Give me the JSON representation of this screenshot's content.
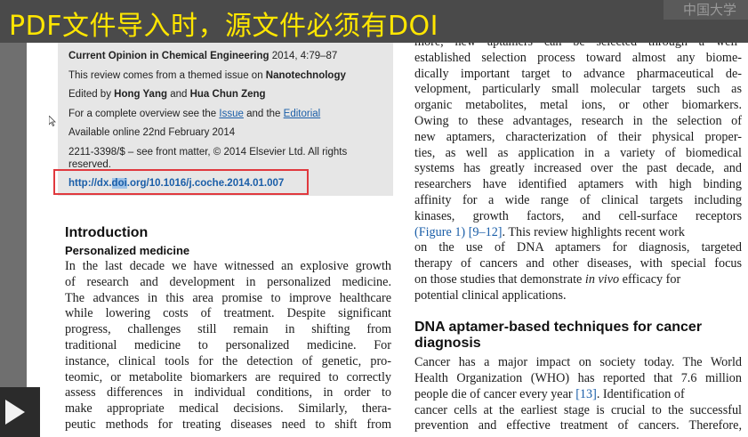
{
  "banner": {
    "title": "PDF文件导入时，源文件必须有DOI",
    "logo_text": "中国大学"
  },
  "infobox": {
    "journal": "Current Opinion in Chemical Engineering",
    "journal_rest": " 2014, 4:79–87",
    "themed_prefix": "This review comes from a themed issue on ",
    "themed_topic": "Nanotechnology",
    "edited_prefix": "Edited by ",
    "editor1": "Hong Yang",
    "and": " and ",
    "editor2": "Hua Chun Zeng",
    "overview_prefix": "For a complete overview see the ",
    "issue_link": "Issue",
    "and_the": " and the ",
    "editorial_link": "Editorial",
    "available": "Available online 22nd February 2014",
    "copyright_line1": "2211-3398/$ – see front matter, © 2014 Elsevier Ltd. All rights",
    "copyright_line2": "reserved.",
    "doi_prefix": "http://dx.",
    "doi_highlight": "doi",
    "doi_suffix": ".org/10.1016/j.coche.2014.01.007"
  },
  "left_column": {
    "heading": "Introduction",
    "subheading": "Personalized medicine",
    "lines": [
      "In the last decade we have witnessed an explosive growth",
      "of research and development in personalized medicine.",
      "The advances in this area promise to improve healthcare",
      "while lowering costs of treatment. Despite significant",
      "progress, challenges still remain in shifting from",
      "traditional medicine to personalized medicine. For",
      "instance, clinical tools for the detection of genetic, pro-",
      "teomic, or metabolite biomarkers are required to correctly",
      "assess differences in individual conditions, in order to",
      "make appropriate medical decisions. Similarly, thera-",
      "peutic methods for treating diseases need to shift from"
    ]
  },
  "right_column": {
    "top_cut": "more, new aptamers can be selected through a well-",
    "lines": [
      "established selection process toward almost any biome-",
      "dically important target to advance pharmaceutical de-",
      "velopment, particularly small molecular targets such as",
      "organic metabolites, metal ions, or other biomarkers.",
      "Owing to these advantages, research in the selection of",
      "new aptamers, characterization of their physical proper-",
      "ties, as well as application in a variety of biomedical",
      "systems has greatly increased over the past decade, and",
      "researchers have identified aptamers with high binding",
      "affinity for a wide range of clinical targets including",
      "kinases, growth factors, and cell-surface receptors"
    ],
    "figure_ref": "(Figure 1)",
    "ref_9_12": "[9–12]",
    "line12_rest": ". This review highlights recent work",
    "line13": "on the use of DNA aptamers for diagnosis, targeted",
    "line14": "therapy of cancers and other diseases, with special focus",
    "line15_prefix": "on those studies that demonstrate ",
    "in_vivo": "in vivo",
    "line15_suffix": " efficacy for",
    "line16": "potential clinical applications.",
    "heading": "DNA aptamer-based techniques for cancer diagnosis",
    "sec_line1": "Cancer has a major impact on society today. The World",
    "sec_line2": "Health Organization (WHO) has reported that 7.6 million",
    "sec_line3_prefix": "people die of cancer every year ",
    "ref_13": "[13]",
    "sec_line3_suffix": ". Identification of",
    "sec_line4": "cancer cells at the earliest stage is crucial to the successful",
    "sec_line5": "prevention and effective treatment of cancers. Therefore,"
  },
  "colors": {
    "banner_text": "#ffe600",
    "highlight_box": "#e0393e",
    "link": "#1a5ea8"
  }
}
